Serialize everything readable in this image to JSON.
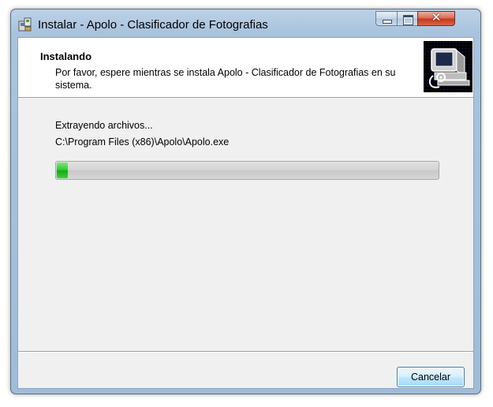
{
  "window": {
    "title": "Instalar - Apolo - Clasificador de Fotografias"
  },
  "header": {
    "title": "Instalando",
    "description": "Por favor, espere mientras se instala Apolo - Clasificador de Fotografias en su sistema."
  },
  "install": {
    "status": "Extrayendo archivos...",
    "current_file": "C:\\Program Files (x86)\\Apolo\\Apolo.exe",
    "progress_fraction": 0.03
  },
  "buttons": {
    "cancel_label": "Cancelar"
  },
  "icons": {
    "app": "installer-icon",
    "minimize": "minimize-icon",
    "maximize": "maximize-icon",
    "close": "close-icon",
    "wizard": "computer-install-icon"
  },
  "colors": {
    "progress": "#22b322",
    "accent": "#3c7fb1"
  }
}
